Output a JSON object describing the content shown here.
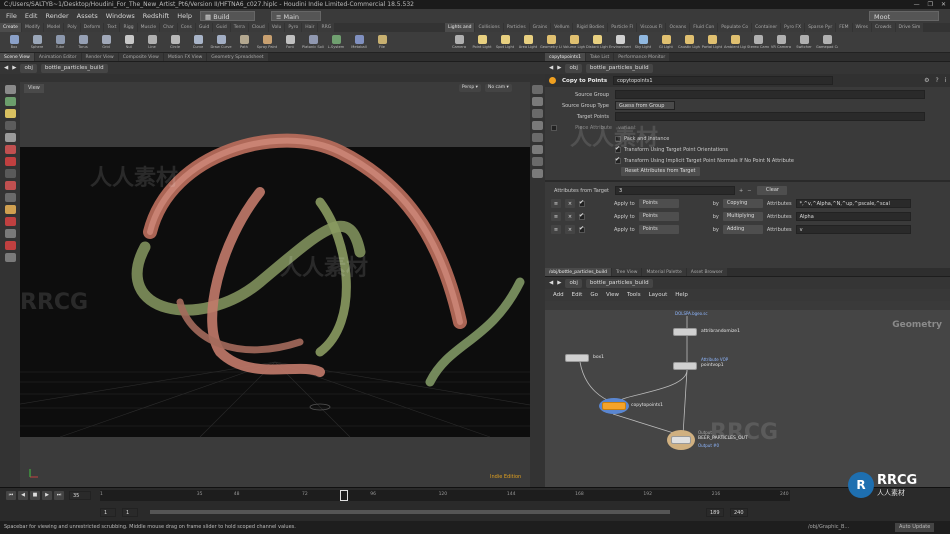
{
  "window": {
    "title": "C:/Users/SALTYB~1/Desktop/Houdini_For_The_New_Artist_Pt6/Version II/HFTNA6_c027.hiplc - Houdini Indie Limited-Commercial 18.5.532",
    "controls": [
      "—",
      "❐",
      "✕"
    ]
  },
  "menu": {
    "items": [
      "File",
      "Edit",
      "Render",
      "Assets",
      "Windows",
      "Redshift",
      "Help"
    ],
    "desktop": "Build",
    "context": "Main",
    "search": "Moot"
  },
  "shelf_left": {
    "tabs": [
      "Create",
      "Modify",
      "Model",
      "Poly",
      "Deform",
      "Text",
      "Rigg",
      "Muscle",
      "Char",
      "Cons",
      "Guid",
      "Guid",
      "Terra",
      "Cloud",
      "Volu",
      "Pyro",
      "Hair",
      "RRG"
    ],
    "active_tab": 0,
    "tools": [
      {
        "label": "Box",
        "color": "#8aa0c8"
      },
      {
        "label": "Sphere",
        "color": "#9aa6b8"
      },
      {
        "label": "Tube",
        "color": "#8c98ad"
      },
      {
        "label": "Torus",
        "color": "#96a0b4"
      },
      {
        "label": "Grid",
        "color": "#a0a8b8"
      },
      {
        "label": "Null",
        "color": "#c8c8c8"
      },
      {
        "label": "Line",
        "color": "#b0b0b0"
      },
      {
        "label": "Circle",
        "color": "#b8b8b8"
      },
      {
        "label": "Curve",
        "color": "#a8b4c8"
      },
      {
        "label": "Draw Curve",
        "color": "#a2aec4"
      },
      {
        "label": "Path",
        "color": "#b4a890"
      },
      {
        "label": "Spray Paint",
        "color": "#c8a070"
      },
      {
        "label": "Font",
        "color": "#c0c0c0"
      },
      {
        "label": "Platonic Solids",
        "color": "#9098b0"
      },
      {
        "label": "L-System",
        "color": "#70a070"
      },
      {
        "label": "Metaball",
        "color": "#8090c0"
      },
      {
        "label": "File",
        "color": "#c8b070"
      }
    ]
  },
  "shelf_right": {
    "tabs": [
      "Lights and",
      "Collisions",
      "Particles",
      "Grains",
      "Vellum",
      "Rigid Bodies",
      "Particle Fl",
      "Viscous Fl",
      "Oceans",
      "Fluid Con",
      "Populate Co",
      "Container",
      "Pyro FX",
      "Sparse Pyr",
      "FEM",
      "Wires",
      "Crowds",
      "Drive Sim"
    ],
    "active_tab": 0,
    "tools": [
      {
        "label": "Camera",
        "color": "#b0b0b0"
      },
      {
        "label": "Point Light",
        "color": "#e8d080"
      },
      {
        "label": "Spot Light",
        "color": "#e8d080"
      },
      {
        "label": "Area Light",
        "color": "#e8d080"
      },
      {
        "label": "Geometry Light",
        "color": "#e0c070"
      },
      {
        "label": "Volume Light",
        "color": "#e0c070"
      },
      {
        "label": "Distant Light",
        "color": "#e8d080"
      },
      {
        "label": "Environment Light",
        "color": "#d0d0d0"
      },
      {
        "label": "Sky Light",
        "color": "#90b8e0"
      },
      {
        "label": "GI Light",
        "color": "#e0c070"
      },
      {
        "label": "Caustic Light",
        "color": "#e0c070"
      },
      {
        "label": "Portal Light",
        "color": "#e0c070"
      },
      {
        "label": "Ambient Light",
        "color": "#e0c070"
      },
      {
        "label": "Stereo Camera",
        "color": "#b0b0b0"
      },
      {
        "label": "VR Camera",
        "color": "#b0b0b0"
      },
      {
        "label": "Switcher",
        "color": "#b0b0b0"
      },
      {
        "label": "Gamepad Camera",
        "color": "#b0b0b0"
      }
    ]
  },
  "left_pane": {
    "tabs": [
      "Scene View",
      "Animation Editor",
      "Render View",
      "Composite View",
      "Motion FX View",
      "Geometry Spreadsheet"
    ],
    "active_tab": 0,
    "path": [
      "obj",
      "bottle_particles_build"
    ],
    "view_label": "View",
    "persp": "Persp",
    "cam": "No cam",
    "footer_label": "Indie Edition"
  },
  "param_pane": {
    "tabs": [
      "copytopoints1",
      "Take List",
      "Performance Monitor"
    ],
    "active_tab": 0,
    "path": [
      "obj",
      "bottle_particles_build"
    ],
    "node_type": "Copy to Points",
    "node_name": "copytopoints1",
    "rows": [
      {
        "label": "Source Group",
        "value": ""
      },
      {
        "label": "Source Group Type",
        "value": "Guess from Group"
      },
      {
        "label": "Target Points",
        "value": ""
      },
      {
        "label": "Piece Attribute",
        "value": "variant"
      }
    ],
    "toggles": [
      {
        "label": "Pack and Instance",
        "checked": false
      },
      {
        "label": "Transform Using Target Point Orientations",
        "checked": true
      },
      {
        "label": "Transform Using Implicit Target Point Normals If No Point N Attribute",
        "checked": true
      }
    ],
    "reset_button": "Reset Attributes from Target",
    "attr_label": "Attributes from Target",
    "attr_count": "3",
    "clear_button": "Clear",
    "attr_rows": [
      {
        "apply_to_label": "Apply to",
        "apply_to": "Points",
        "by_label": "by",
        "by": "Copying",
        "attrs_label": "Attributes",
        "attrs": "*,^v,^Alpha,^N,^up,^pscale,^scal"
      },
      {
        "apply_to_label": "Apply to",
        "apply_to": "Points",
        "by_label": "by",
        "by": "Multiplying",
        "attrs_label": "Attributes",
        "attrs": "Alpha"
      },
      {
        "apply_to_label": "Apply to",
        "apply_to": "Points",
        "by_label": "by",
        "by": "Adding",
        "attrs_label": "Attributes",
        "attrs": "v"
      }
    ]
  },
  "net_pane": {
    "tabs": [
      "/obj/bottle_particles_build",
      "Tree View",
      "Material Palette",
      "Asset Browser"
    ],
    "active_tab": 0,
    "path": [
      "obj",
      "bottle_particles_build"
    ],
    "menu": [
      "Add",
      "Edit",
      "Go",
      "View",
      "Tools",
      "Layout",
      "Help"
    ],
    "context_label": "Geometry",
    "nodes": {
      "solver_label": "DOLSPA.bgeo.sc",
      "attr_label": "attribrandomize1",
      "box_label": "box1",
      "vop_label": "Attribute VOP",
      "vop_name": "pointvop1",
      "copy_label": "copytopoints1",
      "out_type": "Output",
      "out_name": "BEER_PARTICLES_OUT",
      "out_sub": "Output #0"
    }
  },
  "timeline": {
    "frame": "35",
    "start": "1",
    "start2": "1",
    "end": "240",
    "end2": "189",
    "ticks": [
      "1",
      "35",
      "48",
      "72",
      "96",
      "120",
      "144",
      "168",
      "192",
      "216",
      "240"
    ]
  },
  "status": {
    "text": "Spacebar for viewing and unrestricted scrubbing. Middle mouse drag on frame slider to hold scoped channel values.",
    "right_path": "/obj/Graphic_B...",
    "auto_update": "Auto Update"
  },
  "watermarks": [
    "人人素材",
    "RRCG"
  ],
  "logo_text": "RRCG",
  "logo_sub": "人人素材",
  "colors": {
    "accent": "#f0a020",
    "copy_node": "#f5a32a",
    "link": "#8fb7ff"
  }
}
